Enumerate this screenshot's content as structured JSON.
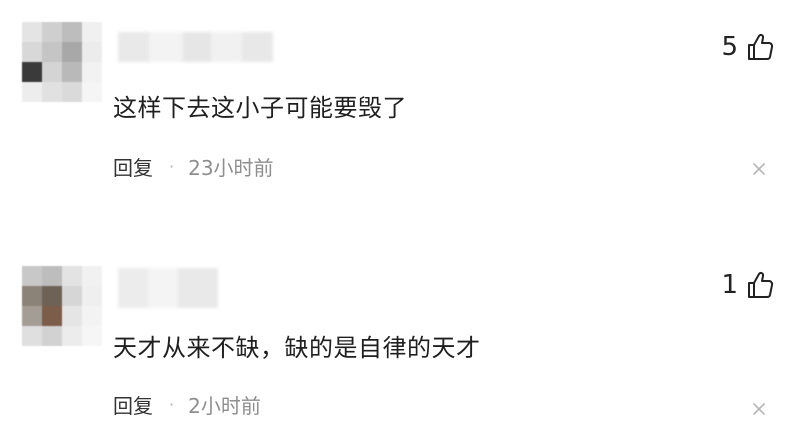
{
  "comments": [
    {
      "likes": "5",
      "text": "这样下去这小子可能要毁了",
      "reply_label": "回复",
      "separator": "·",
      "time": "23小时前"
    },
    {
      "likes": "1",
      "text": "天才从来不缺，缺的是自律的天才",
      "reply_label": "回复",
      "separator": "·",
      "time": "2小时前"
    }
  ],
  "icons": {
    "like": "thumbs-up-icon",
    "close": "close-icon"
  }
}
